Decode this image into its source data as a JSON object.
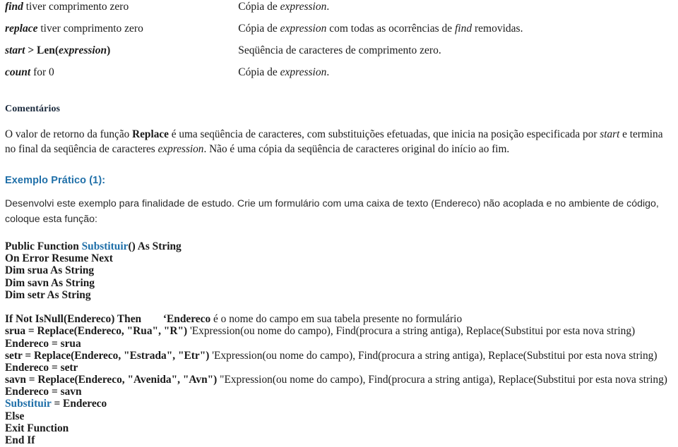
{
  "def_table": {
    "rows": [
      {
        "condition_parts": [
          {
            "text": "find",
            "style": "bi"
          },
          {
            "text": " tiver comprimento zero",
            "style": "plain"
          }
        ],
        "result_parts": [
          {
            "text": "Cópia de ",
            "style": "plain"
          },
          {
            "text": "expression",
            "style": "i"
          },
          {
            "text": ".",
            "style": "plain"
          }
        ]
      },
      {
        "condition_parts": [
          {
            "text": "replace",
            "style": "bi"
          },
          {
            "text": " tiver comprimento zero",
            "style": "plain"
          }
        ],
        "result_parts": [
          {
            "text": "Cópia de ",
            "style": "plain"
          },
          {
            "text": "expression",
            "style": "i"
          },
          {
            "text": " com todas as ocorrências de ",
            "style": "plain"
          },
          {
            "text": "find",
            "style": "i"
          },
          {
            "text": " removidas.",
            "style": "plain"
          }
        ]
      },
      {
        "condition_parts": [
          {
            "text": "start",
            "style": "bi"
          },
          {
            "text": " > ",
            "style": "b"
          },
          {
            "text": "Len(",
            "style": "b"
          },
          {
            "text": "expression",
            "style": "bi"
          },
          {
            "text": ")",
            "style": "b"
          }
        ],
        "result_parts": [
          {
            "text": "Seqüência de caracteres de comprimento zero.",
            "style": "plain"
          }
        ]
      },
      {
        "condition_parts": [
          {
            "text": "count",
            "style": "bi"
          },
          {
            "text": " for 0",
            "style": "plain"
          }
        ],
        "result_parts": [
          {
            "text": "Cópia de ",
            "style": "plain"
          },
          {
            "text": "expression",
            "style": "i"
          },
          {
            "text": ".",
            "style": "plain"
          }
        ]
      }
    ]
  },
  "comentarios": {
    "heading": "Comentários",
    "paragraph_parts": [
      {
        "text": "O valor de retorno da função ",
        "style": "plain"
      },
      {
        "text": "Replace",
        "style": "b"
      },
      {
        "text": " é uma seqüência de caracteres, com substituições efetuadas, que inicia na posição especificada por ",
        "style": "plain"
      },
      {
        "text": "start",
        "style": "i"
      },
      {
        "text": " e termina no final da seqüência de caracteres ",
        "style": "plain"
      },
      {
        "text": "expression",
        "style": "i"
      },
      {
        "text": ". Não é uma cópia da seqüência de caracteres original do início ao fim.",
        "style": "plain"
      }
    ]
  },
  "exemplo": {
    "heading": "Exemplo Prático (1):",
    "paragraph": "Desenvolvi este exemplo para finalidade de estudo. Crie um formulário com uma caixa de texto (Endereco) não acoplada e no ambiente de código, coloque esta função:"
  },
  "code": {
    "lines": [
      {
        "parts": [
          {
            "text": "Public Function ",
            "style": "plain"
          },
          {
            "text": "Substituir",
            "style": "blue"
          },
          {
            "text": "() As String",
            "style": "plain"
          }
        ]
      },
      {
        "parts": [
          {
            "text": "On Error Resume Next",
            "style": "plain"
          }
        ]
      },
      {
        "parts": [
          {
            "text": "Dim srua As String",
            "style": "plain"
          }
        ]
      },
      {
        "parts": [
          {
            "text": "Dim savn As String",
            "style": "plain"
          }
        ]
      },
      {
        "parts": [
          {
            "text": "Dim setr As String",
            "style": "plain"
          }
        ]
      },
      {
        "parts": []
      },
      {
        "parts": [
          {
            "text": "If Not IsNull(Endereco) Then        ‘Endereco",
            "style": "plain"
          },
          {
            "text": " é o nome do campo em sua tabela presente no formulário",
            "style": "comment"
          }
        ]
      },
      {
        "parts": [
          {
            "text": "srua = Replace(Endereco, \"Rua\", \"R\")",
            "style": "plain"
          },
          {
            "text": " 'Expression(ou nome do campo), Find(procura a string antiga), Replace(Substitui por esta nova string)",
            "style": "comment"
          }
        ]
      },
      {
        "parts": [
          {
            "text": "Endereco = srua",
            "style": "plain"
          }
        ]
      },
      {
        "parts": [
          {
            "text": "setr = Replace(Endereco, \"Estrada\", \"Etr\")",
            "style": "plain"
          },
          {
            "text": " 'Expression(ou nome do campo), Find(procura a string antiga), Replace(Substitui por esta nova string)",
            "style": "comment"
          }
        ]
      },
      {
        "parts": [
          {
            "text": "Endereco = setr",
            "style": "plain"
          }
        ]
      },
      {
        "parts": [
          {
            "text": "savn = Replace(Endereco, \"Avenida\", \"Avn\")",
            "style": "plain"
          },
          {
            "text": " \"Expression(ou nome do campo), Find(procura a string antiga), Replace(Substitui por esta nova string)",
            "style": "comment"
          }
        ]
      },
      {
        "parts": [
          {
            "text": "Endereco = savn",
            "style": "plain"
          }
        ]
      },
      {
        "parts": [
          {
            "text": "Substituir",
            "style": "blue"
          },
          {
            "text": " = Endereco",
            "style": "plain"
          }
        ]
      },
      {
        "parts": [
          {
            "text": "Else",
            "style": "plain"
          }
        ]
      },
      {
        "parts": [
          {
            "text": "Exit Function",
            "style": "plain"
          }
        ]
      },
      {
        "parts": [
          {
            "text": "End If",
            "style": "plain"
          }
        ]
      }
    ]
  },
  "colors": {
    "accent_blue": "#1f6fa8",
    "heading_dark": "#1b2a3d",
    "body_text": "#1a1a1a"
  }
}
